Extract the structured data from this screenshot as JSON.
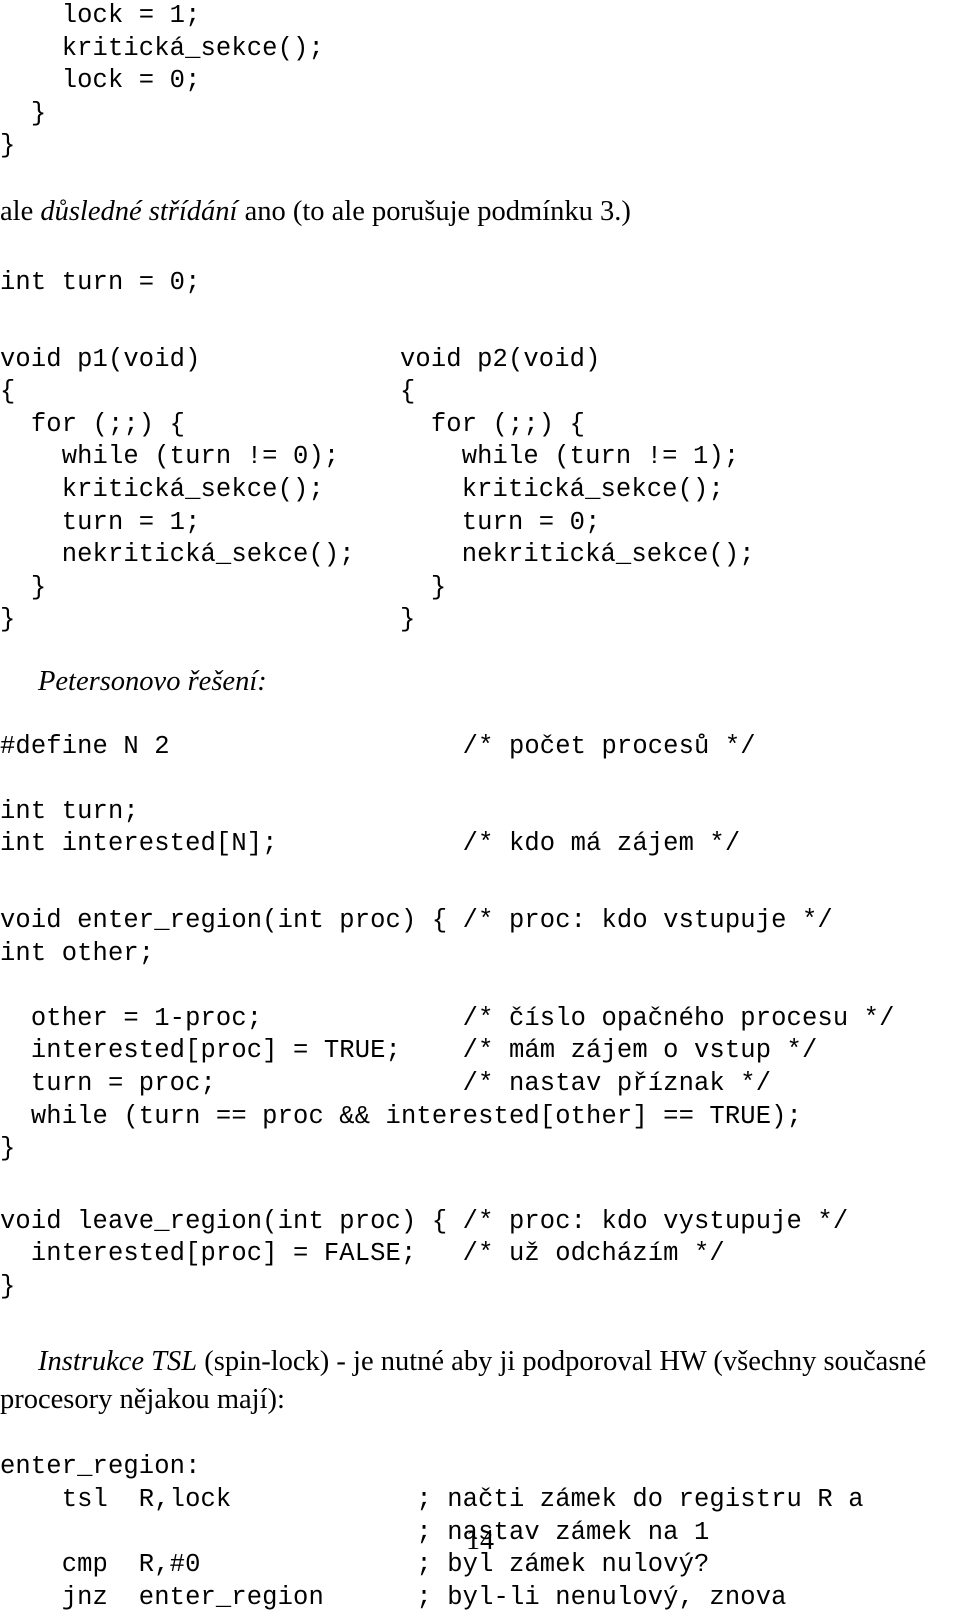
{
  "page": {
    "folio": "14",
    "language": "cs"
  },
  "block_lock_tail": {
    "lines": [
      "    lock = 1;",
      "    kritická_sekce();",
      "    lock = 0;",
      "  }",
      "}"
    ],
    "text": "    lock = 1;\n    kritická_sekce();\n    lock = 0;\n  }\n}"
  },
  "para_strict_alternation": {
    "lead": "ale ",
    "emphasis": "důsledné střídání",
    "tail": " ano (to ale porušuje podmínku 3.)",
    "full_text": "ale důsledné střídání ano (to ale porušuje podmínku 3.)"
  },
  "decl_turn": {
    "text": "int turn = 0;"
  },
  "proc_pair": {
    "left": {
      "name": "p1",
      "text": "void p1(void)\n{\n  for (;;) {\n    while (turn != 0);\n    kritická_sekce();\n    turn = 1;\n    nekritická_sekce();\n  }\n}",
      "lines": [
        "void p1(void)",
        "{",
        "  for (;;) {",
        "    while (turn != 0);",
        "    kritická_sekce();",
        "    turn = 1;",
        "    nekritická_sekce();",
        "  }",
        "}"
      ]
    },
    "right": {
      "name": "p2",
      "text": "void p2(void)\n{\n  for (;;) {\n    while (turn != 1);\n    kritická_sekce();\n    turn = 0;\n    nekritická_sekce();\n  }\n}",
      "lines": [
        "void p2(void)",
        "{",
        "  for (;;) {",
        "    while (turn != 1);",
        "    kritická_sekce();",
        "    turn = 0;",
        "    nekritická_sekce();",
        "  }",
        "}"
      ]
    }
  },
  "heading_peterson": {
    "text": "Petersonovo řešení:"
  },
  "peterson_declarations": {
    "text": "#define N 2                   /* počet procesů */\n\nint turn;\nint interested[N];            /* kdo má zájem */",
    "lines": [
      {
        "code": "#define N 2",
        "comment": "/* počet procesů */"
      },
      {
        "code": "",
        "comment": ""
      },
      {
        "code": "int turn;",
        "comment": ""
      },
      {
        "code": "int interested[N];",
        "comment": "/* kdo má zájem */"
      }
    ]
  },
  "peterson_enter_region": {
    "text": "void enter_region(int proc) { /* proc: kdo vstupuje */\nint other;\n\n  other = 1-proc;             /* číslo opačného procesu */\n  interested[proc] = TRUE;    /* mám zájem o vstup */\n  turn = proc;                /* nastav příznak */\n  while (turn == proc && interested[other] == TRUE);\n}",
    "lines": [
      {
        "code": "void enter_region(int proc) {",
        "comment": "/* proc: kdo vstupuje */"
      },
      {
        "code": "int other;",
        "comment": ""
      },
      {
        "code": "",
        "comment": ""
      },
      {
        "code": "  other = 1-proc;",
        "comment": "/* číslo opačného procesu */"
      },
      {
        "code": "  interested[proc] = TRUE;",
        "comment": "/* mám zájem o vstup */"
      },
      {
        "code": "  turn = proc;",
        "comment": "/* nastav příznak */"
      },
      {
        "code": "  while (turn == proc && interested[other] == TRUE);",
        "comment": ""
      },
      {
        "code": "}",
        "comment": ""
      }
    ]
  },
  "peterson_leave_region": {
    "text": "void leave_region(int proc) { /* proc: kdo vystupuje */\n  interested[proc] = FALSE;   /* už odcházím */\n}",
    "lines": [
      {
        "code": "void leave_region(int proc) {",
        "comment": "/* proc: kdo vystupuje */"
      },
      {
        "code": "  interested[proc] = FALSE;",
        "comment": "/* už odcházím */"
      },
      {
        "code": "}",
        "comment": ""
      }
    ]
  },
  "para_tsl": {
    "emphasis": "Instrukce TSL",
    "tail": " (spin-lock) - je nutné aby ji podporoval HW (všechny současné procesory nějakou mají):",
    "full_text": "Instrukce TSL (spin-lock) - je nutné aby ji podporoval HW (všechny současné procesory nějakou mají):"
  },
  "asm_enter_region": {
    "text": "enter_region:\n    tsl  R,lock            ; načti zámek do registru R a\n                           ; nastav zámek na 1\n    cmp  R,#0              ; byl zámek nulový?\n    jnz  enter_region      ; byl-li nenulový, znova",
    "lines": [
      {
        "label": "enter_region:",
        "mnemonic": "",
        "operands": "",
        "comment": ""
      },
      {
        "label": "",
        "mnemonic": "tsl",
        "operands": "R,lock",
        "comment": "; načti zámek do registru R a"
      },
      {
        "label": "",
        "mnemonic": "",
        "operands": "",
        "comment": "; nastav zámek na 1"
      },
      {
        "label": "",
        "mnemonic": "cmp",
        "operands": "R,#0",
        "comment": "; byl zámek nulový?"
      },
      {
        "label": "",
        "mnemonic": "jnz",
        "operands": "enter_region",
        "comment": "; byl-li nenulový, znova"
      }
    ]
  }
}
